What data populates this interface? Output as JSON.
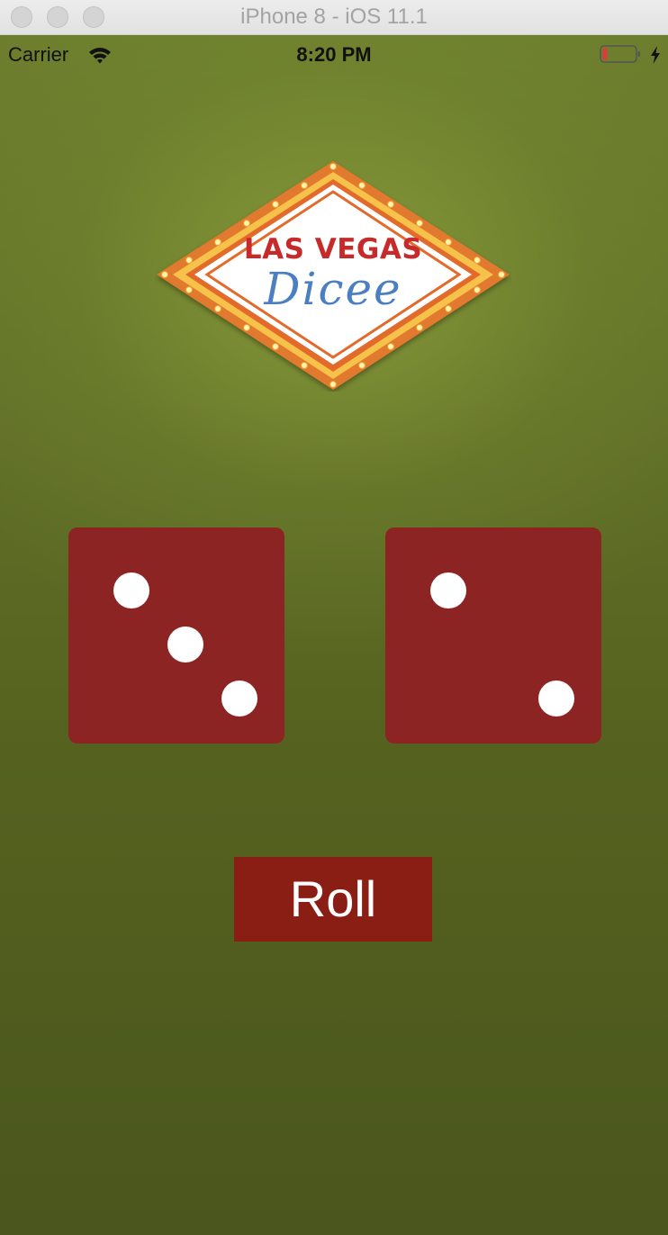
{
  "window": {
    "title": "iPhone 8 - iOS 11.1"
  },
  "statusbar": {
    "carrier": "Carrier",
    "time": "8:20 PM",
    "wifi_icon": "wifi-icon",
    "battery_icon": "battery-low-icon",
    "charging_icon": "charging-bolt-icon"
  },
  "logo": {
    "title": "LAS VEGAS",
    "script": "Dicee"
  },
  "dice": {
    "left": {
      "value": 3
    },
    "right": {
      "value": 2
    }
  },
  "roll_button": {
    "label": "Roll"
  },
  "colors": {
    "background": "#5f6f27",
    "die": "#8d2424",
    "button": "#8a1e15",
    "pip": "#ffffff"
  }
}
